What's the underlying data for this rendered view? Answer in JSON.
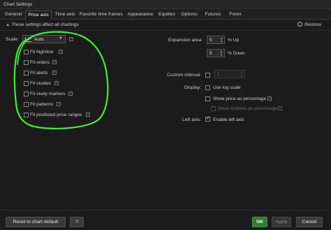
{
  "window": {
    "title": "Chart Settings"
  },
  "tabs": [
    {
      "label": "General"
    },
    {
      "label": "Price axis"
    },
    {
      "label": "Time axis"
    },
    {
      "label": "Favorite time frames"
    },
    {
      "label": "Appearance"
    },
    {
      "label": "Equities"
    },
    {
      "label": "Options"
    },
    {
      "label": "Futures"
    },
    {
      "label": "Forex"
    }
  ],
  "notice": {
    "icon": "warning-icon",
    "text": "These settings affect all chartings"
  },
  "restore": {
    "label": "Restore",
    "icon": "restore-icon"
  },
  "scale": {
    "label": "Scale:",
    "value": "Auto"
  },
  "fit_options": [
    {
      "label": "Fit high/low",
      "checked": false
    },
    {
      "label": "Fit orders",
      "checked": false
    },
    {
      "label": "Fit alerts",
      "checked": false
    },
    {
      "label": "Fit studies",
      "checked": false
    },
    {
      "label": "Fit study markers",
      "checked": false
    },
    {
      "label": "Fit patterns",
      "checked": false
    },
    {
      "label": "Fit predicted price ranges",
      "checked": false
    }
  ],
  "expansion": {
    "label": "Expansion area:",
    "up_value": "5",
    "up_label": "% Up",
    "down_value": "5",
    "down_label": "% Down"
  },
  "custom_interval": {
    "label": "Custom interval:",
    "checked": false,
    "value": "1"
  },
  "display": {
    "label": "Display:",
    "options": [
      {
        "label": "Use log scale",
        "checked": false,
        "disabled": false
      },
      {
        "label": "Show price as percentage",
        "checked": false,
        "disabled": false
      },
      {
        "label": "Show bubbles as percentage",
        "checked": true,
        "disabled": true
      }
    ]
  },
  "left_axis": {
    "label": "Left axis:",
    "option": "Enable left axis",
    "checked": true
  },
  "footer": {
    "reset_label": "Reset to chart default",
    "help_label": "?",
    "ok_label": "OK",
    "apply_label": "Apply",
    "cancel_label": "Cancel"
  },
  "colors": {
    "accent_ok": "#2f7d32",
    "annotation": "#3ef02e",
    "warning": "#e6a100"
  }
}
